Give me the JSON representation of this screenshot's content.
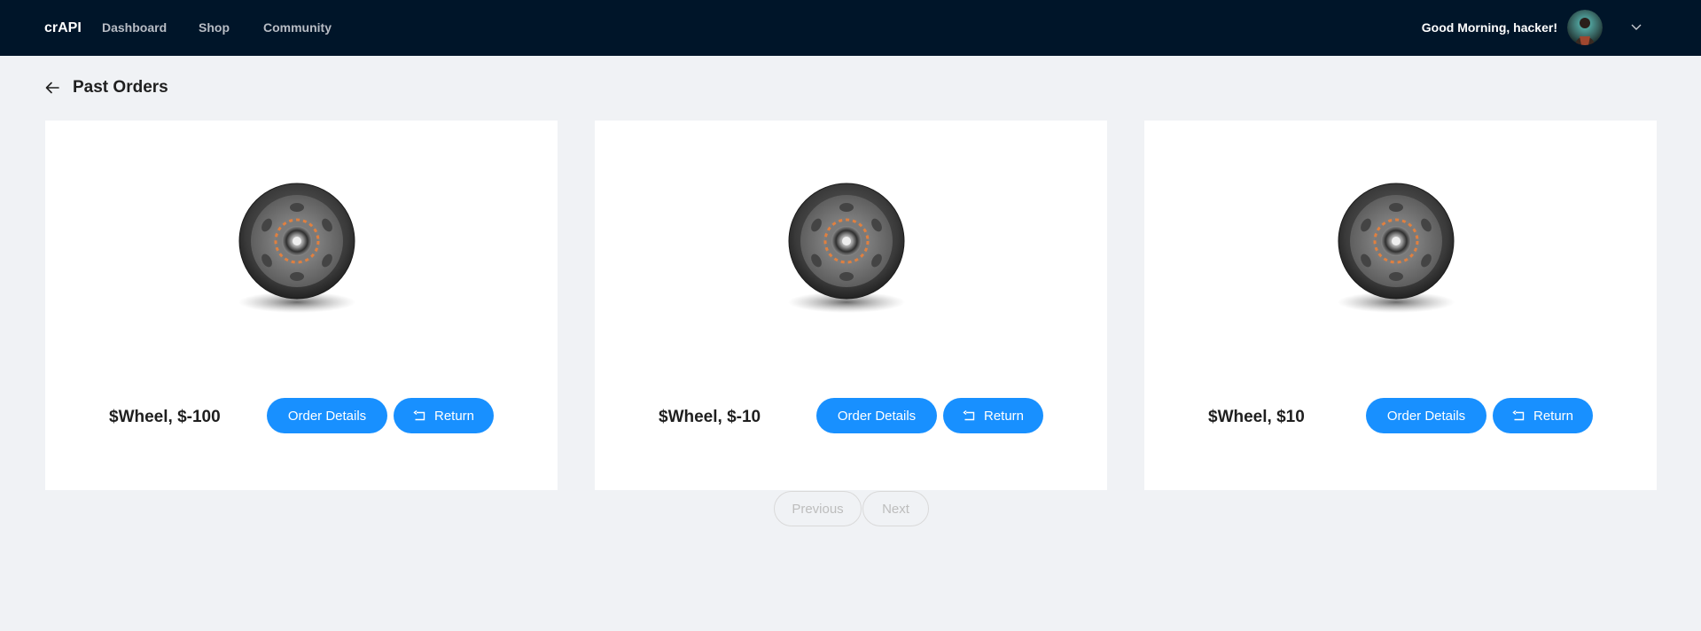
{
  "navbar": {
    "brand": "crAPI",
    "links": [
      "Dashboard",
      "Shop",
      "Community"
    ],
    "greeting": "Good Morning, hacker!",
    "avatar_icon": "user-avatar",
    "menu_icon": "chevron-down-icon"
  },
  "page": {
    "title": "Past Orders",
    "back_icon": "arrow-left-icon"
  },
  "orders": [
    {
      "price_label": "$Wheel, $-100",
      "details_label": "Order Details",
      "return_label": "Return",
      "image": "wheel-image"
    },
    {
      "price_label": "$Wheel, $-10",
      "details_label": "Order Details",
      "return_label": "Return",
      "image": "wheel-image"
    },
    {
      "price_label": "$Wheel, $10",
      "details_label": "Order Details",
      "return_label": "Return",
      "image": "wheel-image"
    }
  ],
  "pagination": {
    "previous_label": "Previous",
    "next_label": "Next"
  },
  "colors": {
    "navbar": "#001529",
    "background": "#f0f2f5",
    "primary": "#1890ff"
  }
}
